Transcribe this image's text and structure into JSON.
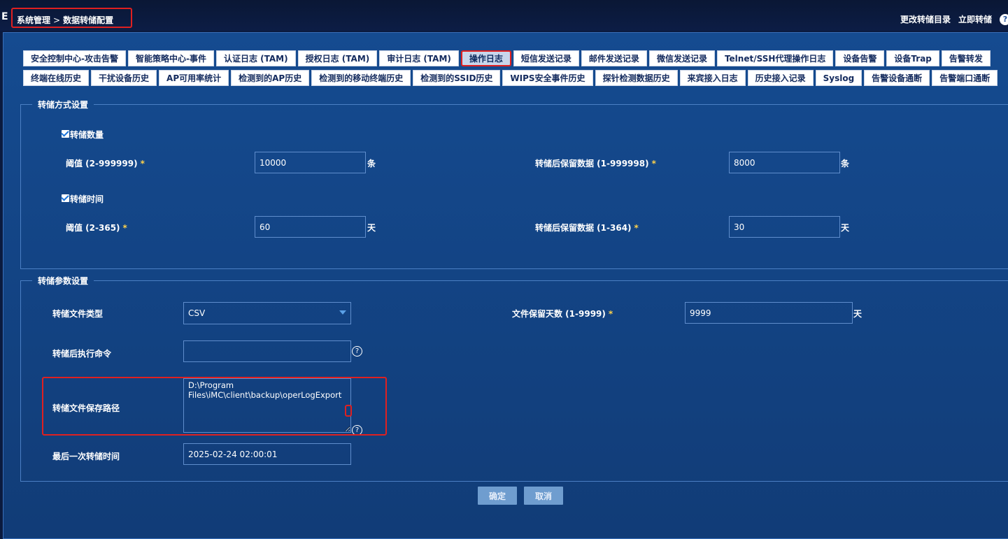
{
  "topbar": {
    "cut_text": "E",
    "breadcrumb": {
      "root": "系统管理",
      "separator": ">",
      "current": "数据转储配置"
    },
    "actions": {
      "change_dir": "更改转储目录",
      "dump_now": "立即转储",
      "help": "?"
    }
  },
  "tabs_row1": [
    "安全控制中心-攻击告警",
    "智能策略中心-事件",
    "认证日志 (TAM)",
    "授权日志 (TAM)",
    "审计日志 (TAM)",
    "操作日志",
    "短信发送记录",
    "邮件发送记录",
    "微信发送记录",
    "Telnet/SSH代理操作日志",
    "设备告警",
    "设备Trap",
    "告警转发"
  ],
  "tabs_row2": [
    "终端在线历史",
    "干扰设备历史",
    "AP可用率统计",
    "检测到的AP历史",
    "检测到的移动终端历史",
    "检测到的SSID历史",
    "WIPS安全事件历史",
    "探针检测数据历史",
    "来宾接入日志",
    "历史接入记录",
    "Syslog",
    "告警设备通断",
    "告警端口通断"
  ],
  "active_tab": "操作日志",
  "dump_mode": {
    "legend": "转储方式设置",
    "by_count": {
      "checkbox_label": "转储数量",
      "threshold_label": "阈值 (2-999999)",
      "threshold_value": "10000",
      "threshold_unit": "条",
      "keep_label": "转储后保留数据 (1-999998)",
      "keep_value": "8000",
      "keep_unit": "条"
    },
    "by_time": {
      "checkbox_label": "转储时间",
      "threshold_label": "阈值 (2-365)",
      "threshold_value": "60",
      "threshold_unit": "天",
      "keep_label": "转储后保留数据 (1-364)",
      "keep_value": "30",
      "keep_unit": "天"
    },
    "required_mark": "*"
  },
  "dump_params": {
    "legend": "转储参数设置",
    "file_type_label": "转储文件类型",
    "file_type_value": "CSV",
    "retention_label": "文件保留天数 (1-9999)",
    "retention_value": "9999",
    "retention_unit": "天",
    "post_cmd_label": "转储后执行命令",
    "post_cmd_value": "",
    "path_label": "转储文件保存路径",
    "path_value": "D:\\Program Files\\iMC\\client\\backup\\operLogExport",
    "last_time_label": "最后一次转储时间",
    "last_time_value": "2025-02-24 02:00:01",
    "help": "?"
  },
  "buttons": {
    "ok": "确定",
    "cancel": "取消"
  }
}
